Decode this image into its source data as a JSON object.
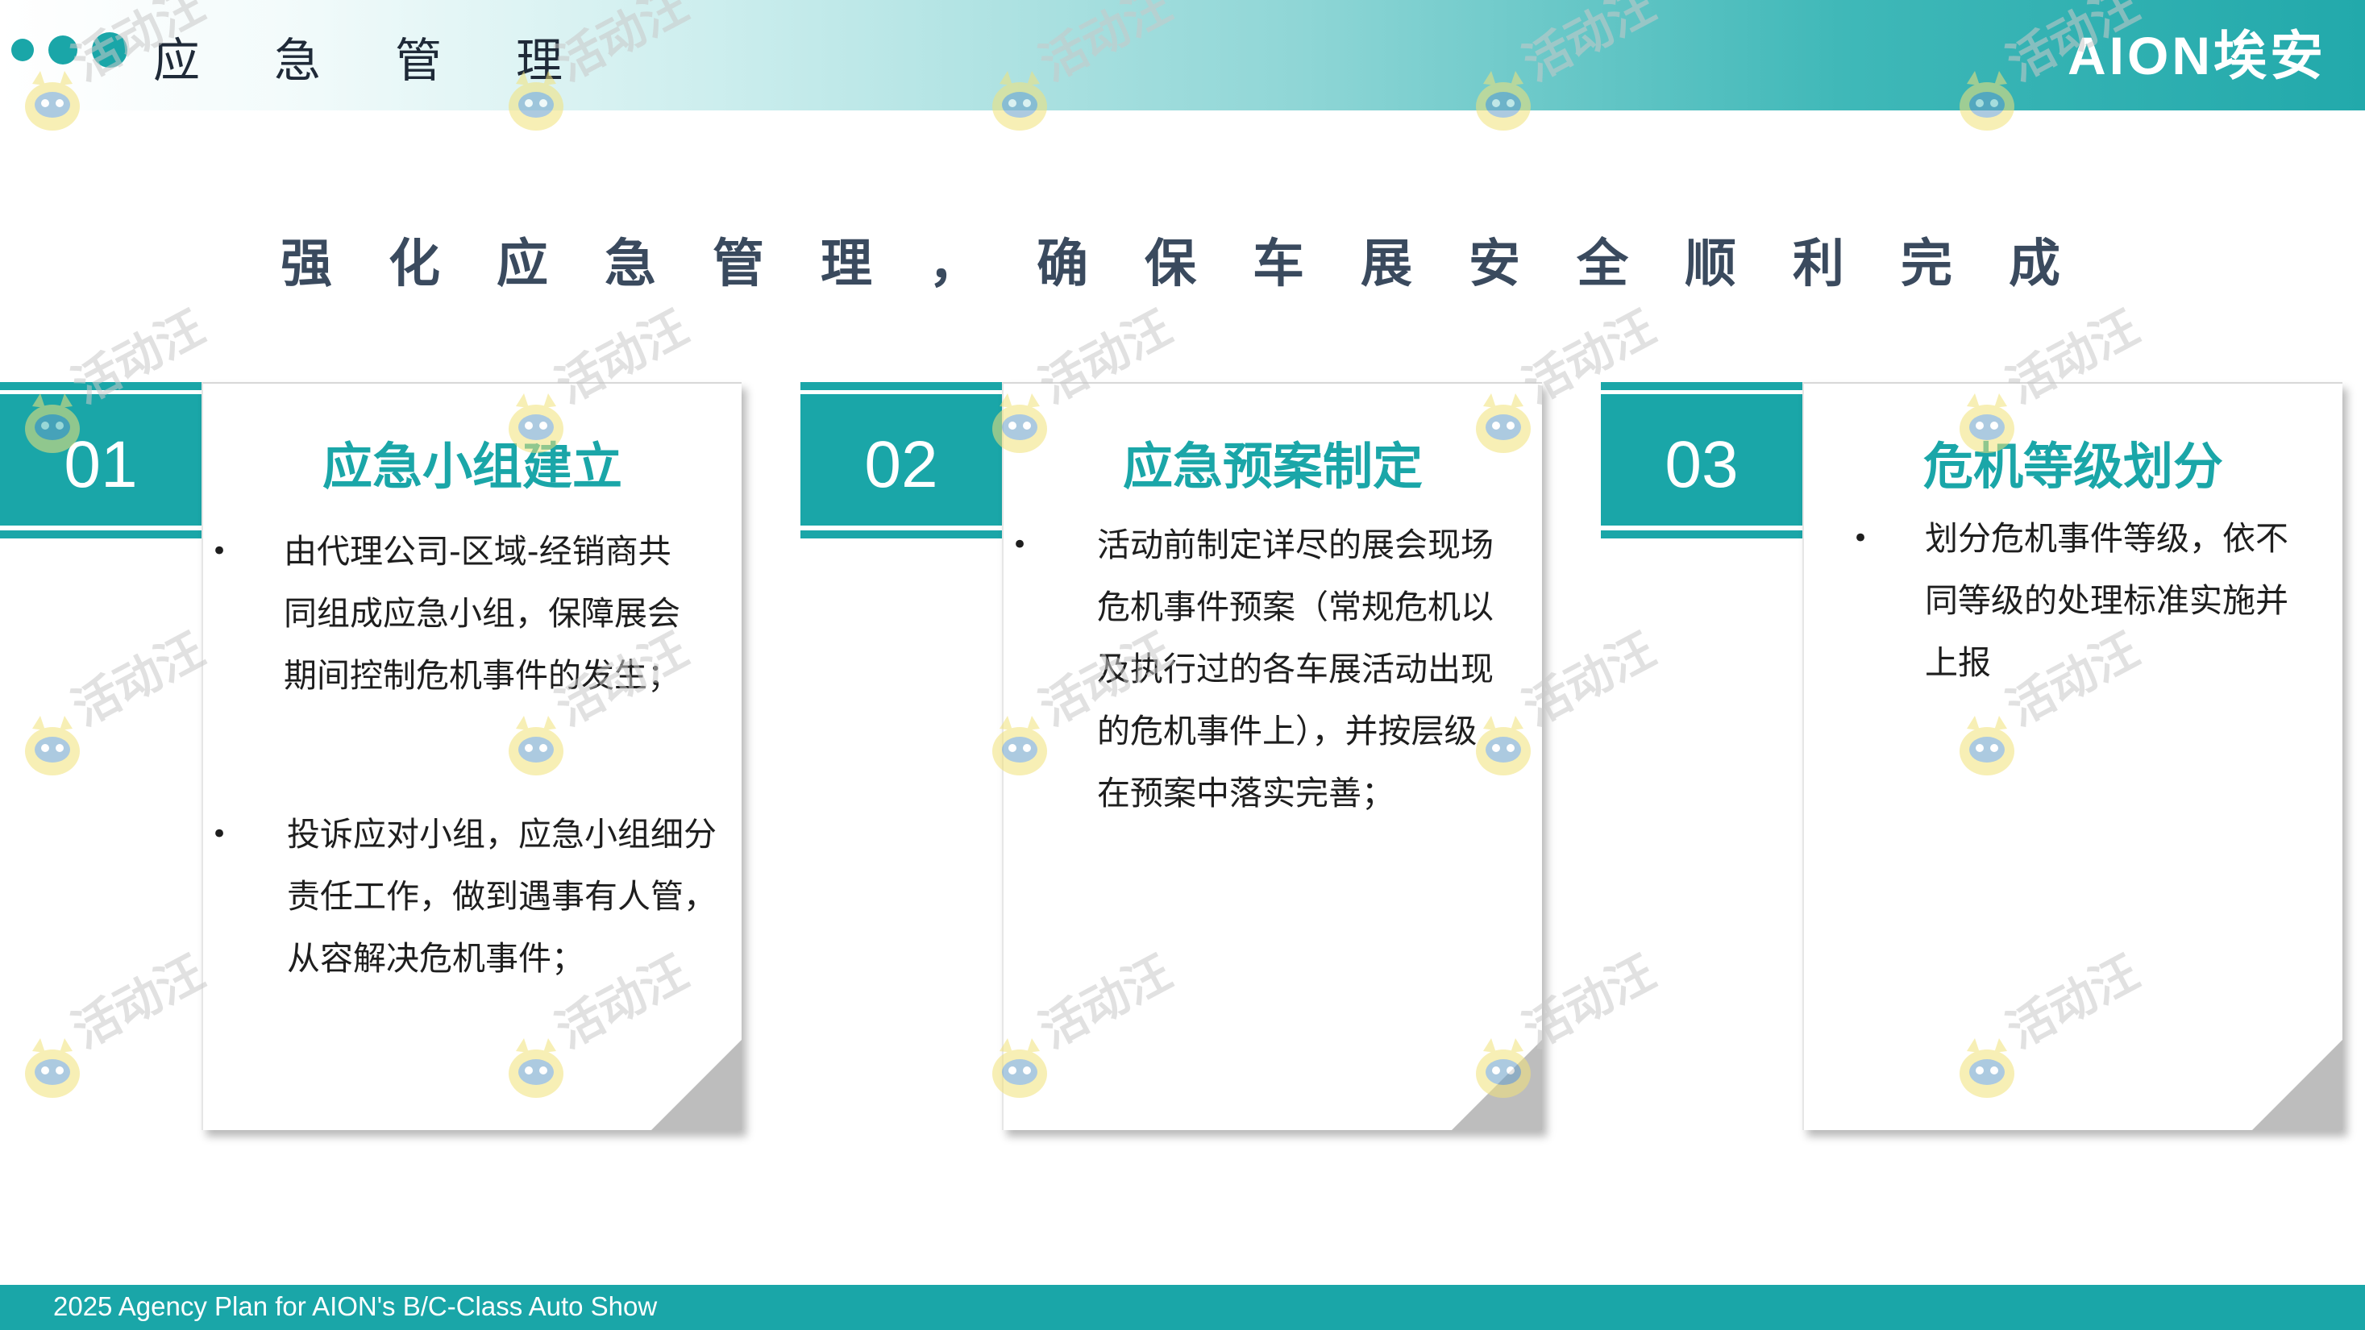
{
  "header": {
    "title": "应急管理",
    "logo_text": "AION埃安"
  },
  "subtitle": "强化应急管理，确保车展安全顺利完成",
  "cards": [
    {
      "number": "01",
      "title": "应急小组建立",
      "bullets": [
        [
          "由代理公司-区域-经销商共",
          "同组成应急小组，保障展会",
          "期间控制危机事件的发生；"
        ],
        [
          "投诉应对小组，应急小组细分",
          "责任工作，做到遇事有人管，",
          "从容解决危机事件；"
        ]
      ]
    },
    {
      "number": "02",
      "title": "应急预案制定",
      "bullets": [
        [
          "活动前制定详尽的展会现场",
          "危机事件预案（常规危机以",
          "及执行过的各车展活动出现",
          "的危机事件上），并按层级",
          "在预案中落实完善；"
        ]
      ]
    },
    {
      "number": "03",
      "title": "危机等级划分",
      "bullets": [
        [
          "划分危机事件等级，依不",
          "同等级的处理标准实施并",
          "上报"
        ]
      ]
    }
  ],
  "watermark_text": "活动汪",
  "footer": {
    "text": "2025 Agency Plan for AION's B/C-Class Auto Show"
  },
  "colors": {
    "accent": "#1aa6a8",
    "title_dark": "#3a4a5e",
    "corner": "#bdbdbd"
  },
  "icons": [
    "dot-icon",
    "mascot-watermark-icon"
  ]
}
